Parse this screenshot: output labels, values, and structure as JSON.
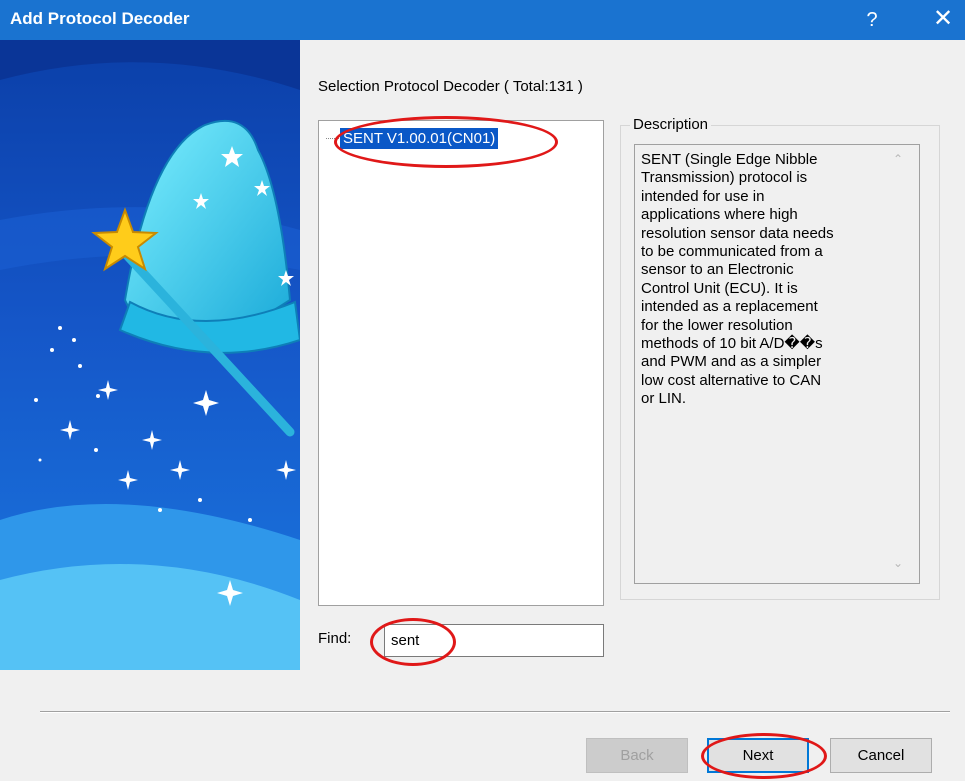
{
  "window": {
    "title": "Add Protocol Decoder",
    "help_glyph": "?",
    "close_glyph": "✕"
  },
  "selection": {
    "label": "Selection Protocol Decoder ( Total:131 )",
    "selected_item": "SENT V1.00.01(CN01)"
  },
  "description": {
    "legend": "Description",
    "text": "SENT (Single Edge Nibble\nTransmission) protocol is\nintended for use in\napplications where high\nresolution sensor data needs\nto be communicated from a\nsensor to an Electronic\nControl Unit (ECU). It is\nintended as a replacement\nfor the lower resolution\nmethods of 10 bit A/D��s\nand PWM and as a simpler\nlow cost alternative to CAN\nor LIN."
  },
  "find": {
    "label": "Find:",
    "value": "sent"
  },
  "buttons": {
    "back": "Back",
    "next": "Next",
    "cancel": "Cancel"
  },
  "colors": {
    "title_bar": "#1a73d0",
    "selection_highlight": "#0a58c7",
    "annotation_circle": "#e01818"
  }
}
